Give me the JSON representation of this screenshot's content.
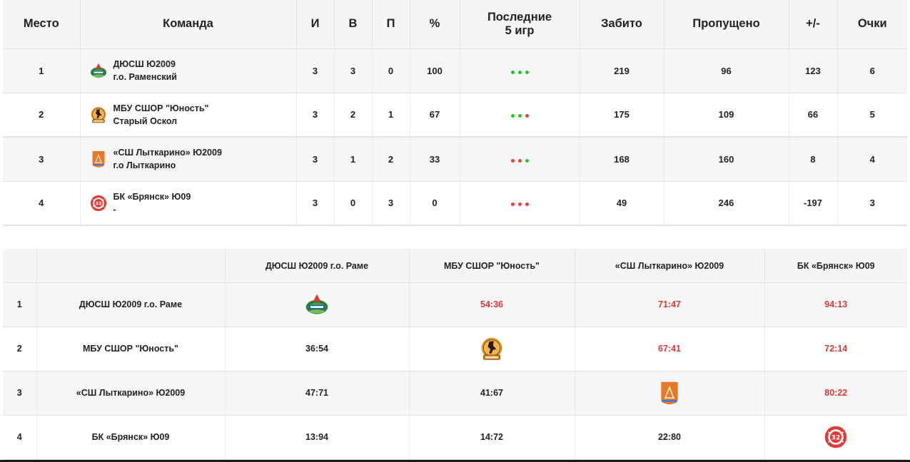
{
  "standings": {
    "headers": {
      "place": "Место",
      "team": "Команда",
      "games": "И",
      "wins": "В",
      "losses": "П",
      "percent": "%",
      "last5_line1": "Последние",
      "last5_line2": "5 игр",
      "scored": "Забито",
      "conceded": "Пропущено",
      "diff": "+/-",
      "points": "Очки"
    },
    "rows": [
      {
        "place": "1",
        "name": "ДЮСШ Ю2009",
        "city": "г.о. Раменский",
        "games": "3",
        "wins": "3",
        "losses": "0",
        "percent": "100",
        "last5": [
          "win",
          "win",
          "win"
        ],
        "scored": "219",
        "conceded": "96",
        "diff": "123",
        "points": "6",
        "logo": "ramenskoe-logo-icon"
      },
      {
        "place": "2",
        "name": "МБУ СШОР \"Юность\"",
        "city": "Старый Оскол",
        "games": "3",
        "wins": "2",
        "losses": "1",
        "percent": "67",
        "last5": [
          "win",
          "win",
          "loss"
        ],
        "scored": "175",
        "conceded": "109",
        "diff": "66",
        "points": "5",
        "logo": "yunost-logo-icon"
      },
      {
        "place": "3",
        "name": "«СШ Лыткарино» Ю2009",
        "city": "г.о Лыткарино",
        "games": "3",
        "wins": "1",
        "losses": "2",
        "percent": "33",
        "last5": [
          "loss",
          "loss",
          "win"
        ],
        "scored": "168",
        "conceded": "160",
        "diff": "8",
        "points": "4",
        "logo": "lytkarino-logo-icon"
      },
      {
        "place": "4",
        "name": "БК «Брянск» Ю09",
        "city": "-",
        "games": "3",
        "wins": "0",
        "losses": "3",
        "percent": "0",
        "last5": [
          "loss",
          "loss",
          "loss"
        ],
        "scored": "49",
        "conceded": "246",
        "diff": "-197",
        "points": "3",
        "logo": "bryansk-logo-icon"
      }
    ]
  },
  "matrix": {
    "columns": [
      "ДЮСШ Ю2009 г.о. Раме",
      "МБУ СШОР \"Юность\"",
      "«СШ Лыткарино» Ю2009",
      "БК «Брянск» Ю09"
    ],
    "rows": [
      {
        "idx": "1",
        "team": "ДЮСШ Ю2009 г.о. Раме",
        "cells": [
          "",
          "54:36",
          "71:47",
          "94:13"
        ]
      },
      {
        "idx": "2",
        "team": "МБУ СШОР \"Юность\"",
        "cells": [
          "36:54",
          "",
          "67:41",
          "72:14"
        ]
      },
      {
        "idx": "3",
        "team": "«СШ Лыткарино» Ю2009",
        "cells": [
          "47:71",
          "41:67",
          "",
          "80:22"
        ]
      },
      {
        "idx": "4",
        "team": "БК «Брянск» Ю09",
        "cells": [
          "13:94",
          "14:72",
          "22:80",
          ""
        ]
      }
    ]
  },
  "colors": {
    "win_dot": "#27c627",
    "loss_dot": "#e0443a",
    "win_score": "#d63b3b",
    "header_bg": "#f5f5f5"
  }
}
